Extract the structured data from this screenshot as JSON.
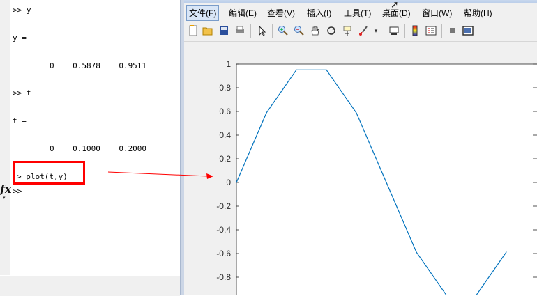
{
  "command_window": {
    "lines": [
      {
        "text": ">> y"
      },
      {
        "text": "y ="
      },
      {
        "text": "        0    0.5878    0.9511"
      },
      {
        "text": ">> t"
      },
      {
        "text": "t ="
      },
      {
        "text": "        0    0.1000    0.2000"
      },
      {
        "text": "> plot(t,y)"
      },
      {
        "text": ">>"
      }
    ],
    "fx_label": "fx",
    "fx_arrow": "▾"
  },
  "figure_window": {
    "menus": [
      "文件(F)",
      "编辑(E)",
      "查看(V)",
      "插入(I)",
      "工具(T)",
      "桌面(D)",
      "窗口(W)",
      "帮助(H)"
    ],
    "toolbar_icons": [
      "new-figure-icon",
      "open-file-icon",
      "save-icon",
      "print-icon",
      "select-arrow-icon",
      "zoom-in-icon",
      "zoom-out-icon",
      "pan-hand-icon",
      "rotate-3d-icon",
      "data-cursor-icon",
      "brush-icon",
      "brush-dropdown-icon",
      "link-plot-icon",
      "colorbar-icon",
      "legend-icon",
      "hide-plot-tools-icon",
      "show-plot-tools-icon"
    ]
  },
  "annotation": {
    "color": "#ff0000"
  },
  "chart_data": {
    "type": "line",
    "x": [
      0,
      0.1,
      0.2,
      0.3,
      0.4,
      0.5,
      0.6,
      0.7,
      0.8,
      0.9
    ],
    "y": [
      0,
      0.5878,
      0.9511,
      0.9511,
      0.5878,
      0,
      -0.5878,
      -0.9511,
      -0.9511,
      -0.5878
    ],
    "ylim": [
      -1,
      1
    ],
    "yticks": [
      "1",
      "0.8",
      "0.6",
      "0.4",
      "0.2",
      "0",
      "-0.2",
      "-0.4",
      "-0.6",
      "-0.8"
    ],
    "line_color": "#0072bd",
    "grid": false
  }
}
